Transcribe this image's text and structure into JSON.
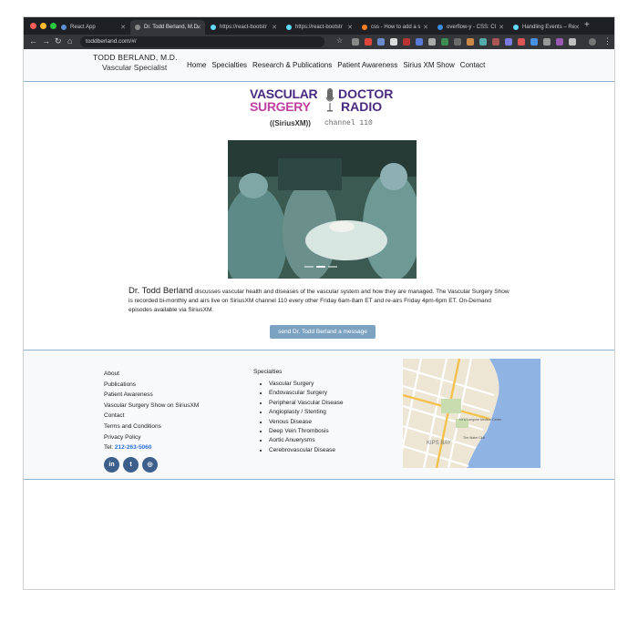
{
  "browser": {
    "tabs": [
      {
        "label": "React App"
      },
      {
        "label": "Dr. Todd Berland, M.D."
      },
      {
        "label": "https://react-bootstr"
      },
      {
        "label": "https://react-bootstr"
      },
      {
        "label": "css - How to add a s"
      },
      {
        "label": "overflow-y - CSS: Cl"
      },
      {
        "label": "Handling Events – Re"
      }
    ],
    "address": "toddberland.com/#/",
    "new_tab_symbol": "+"
  },
  "site": {
    "brand_name": "TODD BERLAND, M.D.",
    "brand_subtitle": "Vascular Specialist",
    "nav": [
      "Home",
      "Specialties",
      "Research & Publications",
      "Patient Awareness",
      "Sirius XM Show",
      "Contact"
    ],
    "logo": {
      "word1": "VASCULAR",
      "word2": "SURGERY",
      "word3": "DOCTOR",
      "word4": "RADIO",
      "sirius": "((SiriusXM))",
      "channel": "channel 110"
    },
    "description_name": "Dr. Todd Berland",
    "description_rest": " discusses vascular health and diseases of the vascular system and how they are managed. The Vascular Surgery Show is recorded bi-monthly and airs live on SiriusXM channel 110 every other Friday 6am-8am ET and re-airs Friday 4pm-6pm ET. On-Demand episodes available via SiriusXM.",
    "cta": "send Dr. Todd Berland a message"
  },
  "footer": {
    "links": [
      "About",
      "Publications",
      "Patient Awareness",
      "Vascular Surgery Show on SiriusXM",
      "Contact",
      "Terms and Conditions",
      "Privacy Policy"
    ],
    "phone_label": "Tel: ",
    "phone": "212-263-5060",
    "specialties_title": "Specialties",
    "specialties": [
      "Vascular Surgery",
      "Endovascular Surgery",
      "Peripheral Vascular Disease",
      "Angioplasty / Stenting",
      "Venous Disease",
      "Deep Vein Thrombosis",
      "Aortic Anuerysms",
      "Cerebrovascular Disease"
    ],
    "socials": [
      {
        "icon": "linkedin-icon",
        "glyph": "in"
      },
      {
        "icon": "twitter-icon",
        "glyph": "t"
      },
      {
        "icon": "instagram-icon",
        "glyph": "◎"
      }
    ],
    "map_labels": {
      "area": "KIPS BAY",
      "hospital": "NYU Langone Medical Center",
      "club": "The Water Club"
    }
  },
  "colors": {
    "accent": "#7ca2c2",
    "brand_purple": "#4a2a80",
    "brand_pink": "#c040a0",
    "link_blue": "#2a6fd6"
  }
}
